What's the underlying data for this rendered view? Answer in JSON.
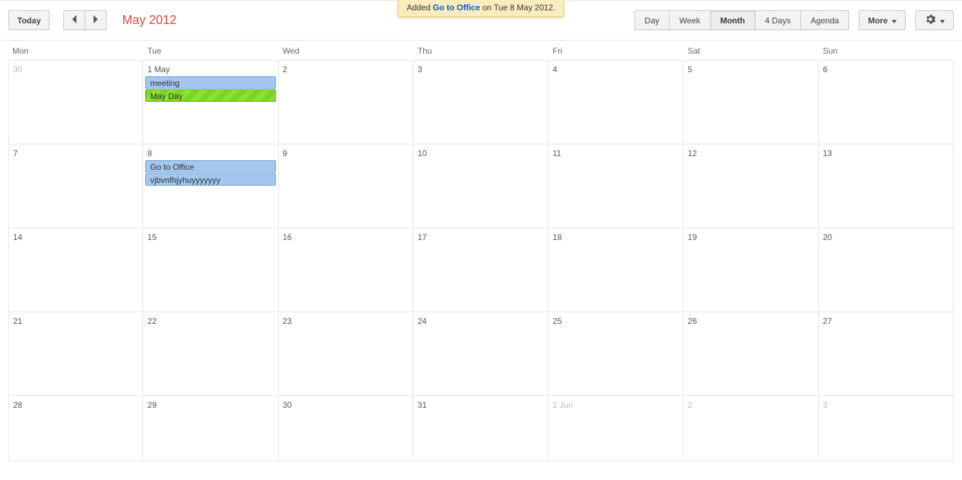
{
  "toast": {
    "prefix": "Added ",
    "link": "Go to Office",
    "suffix": " on Tue 8 May 2012."
  },
  "toolbar": {
    "today": "Today",
    "period": "May 2012",
    "views": {
      "day": "Day",
      "week": "Week",
      "month": "Month",
      "four": "4 Days",
      "agenda": "Agenda"
    },
    "more": "More"
  },
  "dayHeaders": [
    "Mon",
    "Tue",
    "Wed",
    "Thu",
    "Fri",
    "Sat",
    "Sun"
  ],
  "weeks": [
    {
      "days": [
        {
          "label": "30",
          "muted": true,
          "events": []
        },
        {
          "label": "1 May",
          "muted": false,
          "events": [
            {
              "title": "meeting",
              "style": "blue"
            },
            {
              "title": "May Day",
              "style": "green"
            }
          ]
        },
        {
          "label": "2",
          "muted": false,
          "events": []
        },
        {
          "label": "3",
          "muted": false,
          "events": []
        },
        {
          "label": "4",
          "muted": false,
          "events": []
        },
        {
          "label": "5",
          "muted": false,
          "events": []
        },
        {
          "label": "6",
          "muted": false,
          "events": []
        }
      ]
    },
    {
      "days": [
        {
          "label": "7",
          "muted": false,
          "events": []
        },
        {
          "label": "8",
          "muted": false,
          "events": [
            {
              "title": "Go to Office",
              "style": "blue"
            },
            {
              "title": "vjbvnfhjyhuyyyyyyy",
              "style": "blue"
            }
          ]
        },
        {
          "label": "9",
          "muted": false,
          "events": []
        },
        {
          "label": "10",
          "muted": false,
          "events": []
        },
        {
          "label": "11",
          "muted": false,
          "events": []
        },
        {
          "label": "12",
          "muted": false,
          "events": []
        },
        {
          "label": "13",
          "muted": false,
          "events": []
        }
      ]
    },
    {
      "days": [
        {
          "label": "14",
          "muted": false,
          "events": []
        },
        {
          "label": "15",
          "muted": false,
          "events": []
        },
        {
          "label": "16",
          "muted": false,
          "events": []
        },
        {
          "label": "17",
          "muted": false,
          "events": []
        },
        {
          "label": "18",
          "muted": false,
          "events": []
        },
        {
          "label": "19",
          "muted": false,
          "events": []
        },
        {
          "label": "20",
          "muted": false,
          "events": []
        }
      ]
    },
    {
      "days": [
        {
          "label": "21",
          "muted": false,
          "events": []
        },
        {
          "label": "22",
          "muted": false,
          "events": []
        },
        {
          "label": "23",
          "muted": false,
          "events": []
        },
        {
          "label": "24",
          "muted": false,
          "events": []
        },
        {
          "label": "25",
          "muted": false,
          "events": []
        },
        {
          "label": "26",
          "muted": false,
          "events": []
        },
        {
          "label": "27",
          "muted": false,
          "events": []
        }
      ]
    },
    {
      "days": [
        {
          "label": "28",
          "muted": false,
          "events": []
        },
        {
          "label": "29",
          "muted": false,
          "events": []
        },
        {
          "label": "30",
          "muted": false,
          "events": []
        },
        {
          "label": "31",
          "muted": false,
          "events": []
        },
        {
          "label": "1 Jun",
          "muted": true,
          "events": []
        },
        {
          "label": "2",
          "muted": true,
          "events": []
        },
        {
          "label": "3",
          "muted": true,
          "events": []
        }
      ]
    }
  ]
}
